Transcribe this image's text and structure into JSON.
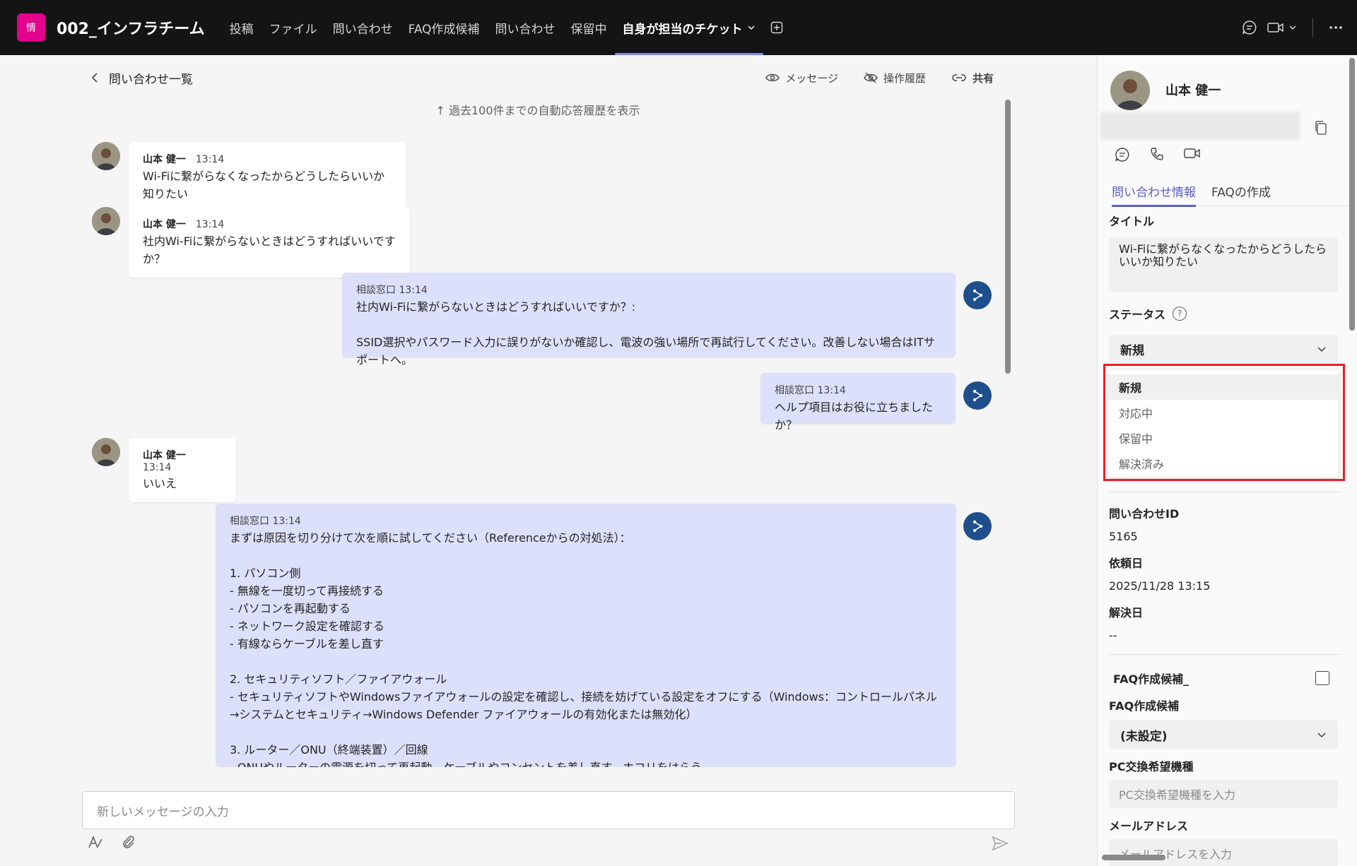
{
  "topbar": {
    "app_icon_text": "情",
    "team_name": "002_インフラチーム",
    "tabs": [
      "投稿",
      "ファイル",
      "問い合わせ",
      "FAQ作成候補",
      "問い合わせ",
      "保留中",
      "自身が担当のチケット"
    ],
    "active_tab_index": 6
  },
  "chat": {
    "back_label": "問い合わせ一覧",
    "actions": {
      "message": "メッセージ",
      "history": "操作履歴",
      "share": "共有"
    },
    "history_link": "↑ 過去100件までの自動応答履歴を表示",
    "messages": [
      {
        "sender": "山本 健一",
        "time": "13:14",
        "text": "Wi-Fiに繋がらなくなったからどうしたらいいか知りたい"
      },
      {
        "sender": "山本 健一",
        "time": "13:14",
        "text": "社内Wi-Fiに繋がらないときはどうすればいいですか？"
      },
      {
        "header": "相談窓口 13:14",
        "text": "社内Wi-Fiに繋がらないときはどうすればいいですか？:\n\nSSID選択やパスワード入力に誤りがないか確認し、電波の強い場所で再試行してください。改善しない場合はITサポートへ。"
      },
      {
        "header": "相談窓口 13:14",
        "text": "ヘルプ項目はお役に立ちましたか？"
      },
      {
        "sender": "山本 健一",
        "time": "13:14",
        "text": "いいえ"
      },
      {
        "header": "相談窓口 13:14",
        "text": "まずは原因を切り分けて次を順に試してください（Referenceからの対処法）：\n\n1. パソコン側\n- 無線を一度切って再接続する\n- パソコンを再起動する\n- ネットワーク設定を確認する\n- 有線ならケーブルを差し直す\n\n2. セキュリティソフト／ファイアウォール\n- セキュリティソフトやWindowsファイアウォールの設定を確認し、接続を妨げている設定をオフにする（Windows：コントロールパネル→システムとセキュリティ→Windows Defender ファイアウォールの有効化または無効化）\n\n3. ルーター／ONU（終端装置）／回線\n- ONUやルーターの電源を切って再起動、ケーブルやコンセントを差し直す、ホコリをはらう"
      }
    ],
    "compose_placeholder": "新しいメッセージの入力"
  },
  "panel": {
    "user_name": "山本 健一",
    "tabs": [
      "問い合わせ情報",
      "FAQの作成"
    ],
    "active_tab_index": 0,
    "title_label": "タイトル",
    "title_value": "Wi-Fiに繋がらなくなったからどうしたらいいか知りたい",
    "status_label": "ステータス",
    "status_help": "?",
    "status_value": "新規",
    "status_options": [
      "新規",
      "対応中",
      "保留中",
      "解決済み"
    ],
    "inquiry_id_label": "問い合わせID",
    "inquiry_id": "5165",
    "request_date_label": "依頼日",
    "request_date": "2025/11/28 13:15",
    "resolved_date_label": "解決日",
    "resolved_date": "--",
    "faq_candidate_check_label": "FAQ作成候補_",
    "faq_candidate_label": "FAQ作成候補",
    "faq_candidate_value": "(未設定)",
    "pc_model_label": "PC交換希望機種",
    "pc_model_placeholder": "PC交換希望機種を入力",
    "email_label": "メールアドレス",
    "email_placeholder": "メールアドレスを入力"
  },
  "colors": {
    "topbar_bg": "#141414",
    "app_tile": "#e3008c",
    "outgoing_bubble": "#dde0fa",
    "bot_icon": "#1f4e8c",
    "accent": "#5b5fc7",
    "highlight_box": "#e5202e"
  }
}
